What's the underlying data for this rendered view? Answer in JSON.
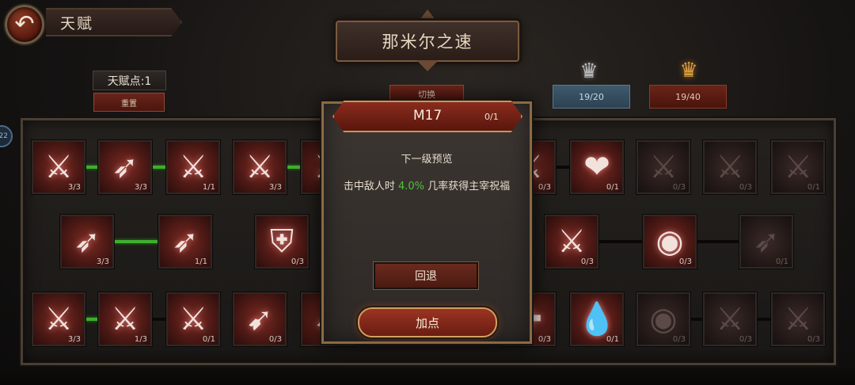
{
  "header": {
    "back_icon": "back-arrow-icon",
    "screen_title": "天赋",
    "tree_name": "那米尔之速"
  },
  "talent": {
    "points_label": "天赋点:1",
    "reset_label": "重置",
    "switch_label": "切换"
  },
  "ranks": {
    "silver_icon": "silver-crown-emblem-icon",
    "gold_icon": "gold-crown-emblem-icon",
    "silver_value": "19/20",
    "gold_value": "19/40"
  },
  "side_badge": "22",
  "colors": {
    "accent_red": "#8a2c1e",
    "connector_active": "#3fae2c",
    "highlight_green": "#4ec43a",
    "gold_trim": "#c8965a"
  },
  "nodes": [
    {
      "id": "r1c1",
      "icon": "broken-sword-icon",
      "glyph": "⚔",
      "count": "3/3",
      "state": "active"
    },
    {
      "id": "r1c2",
      "icon": "winged-boot-icon",
      "glyph": "➶",
      "count": "3/3",
      "state": "active"
    },
    {
      "id": "r1c3",
      "icon": "swift-sword-icon",
      "glyph": "⚔",
      "count": "1/1",
      "state": "active"
    },
    {
      "id": "r1c4",
      "icon": "slashing-sword-icon",
      "glyph": "⚔",
      "count": "3/3",
      "state": "active"
    },
    {
      "id": "r1c5",
      "icon": "sword-icon",
      "glyph": "⚔",
      "count": "",
      "state": "active"
    },
    {
      "id": "r1c7",
      "icon": "sword-icon",
      "glyph": "⚔",
      "count": "0/3",
      "state": "active"
    },
    {
      "id": "r1c8",
      "icon": "heart-icon",
      "glyph": "❤",
      "count": "0/1",
      "state": "active"
    },
    {
      "id": "r1c9",
      "icon": "slashing-sword-icon",
      "glyph": "⚔",
      "count": "0/3",
      "state": "locked"
    },
    {
      "id": "r1c10",
      "icon": "broken-sword-icon",
      "glyph": "⚔",
      "count": "0/3",
      "state": "locked"
    },
    {
      "id": "r1c11",
      "icon": "broken-sword-icon",
      "glyph": "⚔",
      "count": "0/1",
      "state": "locked"
    },
    {
      "id": "r2c1",
      "icon": "winged-boot-icon",
      "glyph": "➶",
      "count": "3/3",
      "state": "active"
    },
    {
      "id": "r2c2",
      "icon": "winged-boot-icon",
      "glyph": "➶",
      "count": "1/1",
      "state": "active"
    },
    {
      "id": "r2c3",
      "icon": "shield-icon",
      "glyph": "⛨",
      "count": "0/3",
      "state": "active"
    },
    {
      "id": "r2c4",
      "icon": "slashing-sword-icon",
      "glyph": "⚔",
      "count": "0/3",
      "state": "active"
    },
    {
      "id": "r2c5",
      "icon": "eye-icon",
      "glyph": "◉",
      "count": "0/3",
      "state": "active"
    },
    {
      "id": "r2c6",
      "icon": "winged-boot-icon",
      "glyph": "➶",
      "count": "0/1",
      "state": "locked"
    },
    {
      "id": "r3c1",
      "icon": "winged-sword-icon",
      "glyph": "⚔",
      "count": "3/3",
      "state": "active"
    },
    {
      "id": "r3c2",
      "icon": "winged-sword-icon",
      "glyph": "⚔",
      "count": "1/3",
      "state": "active"
    },
    {
      "id": "r3c3",
      "icon": "winged-sword-icon",
      "glyph": "⚔",
      "count": "0/1",
      "state": "active"
    },
    {
      "id": "r3c4",
      "icon": "bow-icon",
      "glyph": "➹",
      "count": "0/3",
      "state": "active"
    },
    {
      "id": "r3c5",
      "icon": "arrow-icon",
      "glyph": "➹",
      "count": "",
      "state": "active"
    },
    {
      "id": "r3c7",
      "icon": "cross-icon",
      "glyph": "✚",
      "count": "0/3",
      "state": "active"
    },
    {
      "id": "r3c8",
      "icon": "blood-drop-plus-icon",
      "glyph": "💧",
      "count": "0/1",
      "state": "active"
    },
    {
      "id": "r3c9",
      "icon": "eye-icon",
      "glyph": "◉",
      "count": "0/3",
      "state": "locked"
    },
    {
      "id": "r3c10",
      "icon": "winged-sword-icon",
      "glyph": "⚔",
      "count": "0/3",
      "state": "locked"
    },
    {
      "id": "r3c11",
      "icon": "sword-icon",
      "glyph": "⚔",
      "count": "0/3",
      "state": "locked"
    }
  ],
  "modal": {
    "title": "M17",
    "level": "0/1",
    "subtitle": "下一级预览",
    "desc_before": "击中敌人时 ",
    "desc_value": "4.0%",
    "desc_after": " 几率获得主宰祝福",
    "revert_label": "回退",
    "add_label": "加点"
  }
}
